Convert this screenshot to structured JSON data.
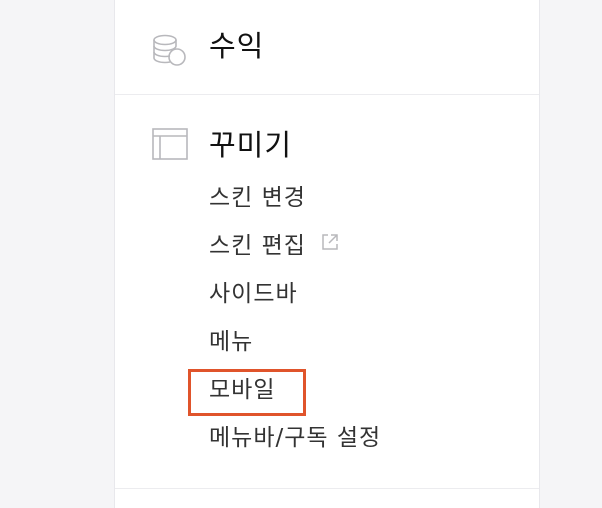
{
  "sections": {
    "revenue": {
      "title": "수익",
      "icon": "coins-icon"
    },
    "decorate": {
      "title": "꾸미기",
      "icon": "layout-icon",
      "items": [
        {
          "label": "스킨 변경"
        },
        {
          "label": "스킨 편집",
          "icon": "external-link-icon"
        },
        {
          "label": "사이드바"
        },
        {
          "label": "메뉴"
        },
        {
          "label": "모바일",
          "highlighted": true
        },
        {
          "label": "메뉴바/구독 설정"
        }
      ]
    }
  },
  "colors": {
    "highlight": "#e0542b",
    "icon_gray": "#b8b8bc"
  }
}
